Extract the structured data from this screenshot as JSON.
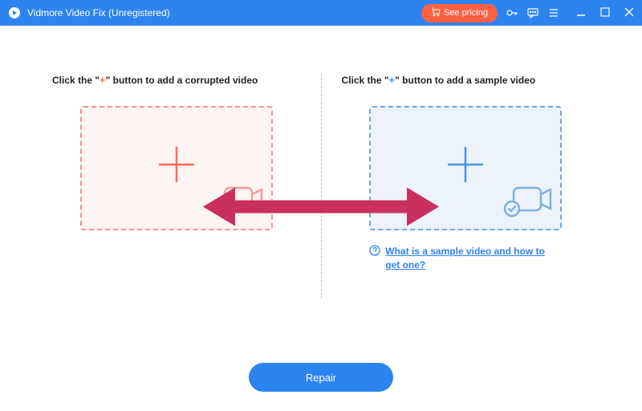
{
  "titlebar": {
    "app_title": "Vidmore Video Fix (Unregistered)",
    "see_pricing": "See pricing"
  },
  "left": {
    "label_prefix": "Click the \"",
    "label_plus": "+",
    "label_suffix": "\" button to add a corrupted video"
  },
  "right": {
    "label_prefix": "Click the \"",
    "label_plus": "+",
    "label_suffix": "\" button to add a sample video",
    "help_text": "What is a sample video and how to get one?"
  },
  "footer": {
    "repair_label": "Repair"
  },
  "colors": {
    "primary": "#2d84ee",
    "accent": "#ff6042",
    "left_plus": "#ff6b5b",
    "right_plus": "#4a90e2",
    "arrow": "#c9305f"
  }
}
